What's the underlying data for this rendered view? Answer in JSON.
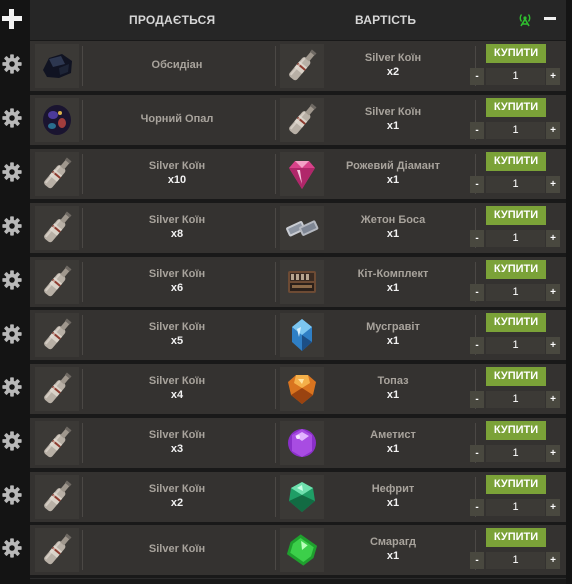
{
  "header": {
    "sells_label": "ПРОДАЄТЬСЯ",
    "cost_label": "ВАРТІСТЬ"
  },
  "colors": {
    "buy_button": "#7ba238",
    "row_background": "#343230",
    "text_name": "#a8a39c",
    "text_qty": "#f2f2f2",
    "accent_icon": "#2fbf2f"
  },
  "rows": [
    {
      "sell": {
        "name": "Обсидіан",
        "qty": "",
        "icon": "obsidian-icon"
      },
      "cost": {
        "name": "Silver Коїн",
        "qty": "x2",
        "icon": "silver-coin-bottle-icon"
      },
      "buy_label": "КУПИТИ",
      "quantity": "1",
      "minus": "-",
      "plus": "+"
    },
    {
      "sell": {
        "name": "Чорний Опал",
        "qty": "",
        "icon": "black-opal-icon"
      },
      "cost": {
        "name": "Silver Коїн",
        "qty": "x1",
        "icon": "silver-coin-bottle-icon"
      },
      "buy_label": "КУПИТИ",
      "quantity": "1",
      "minus": "-",
      "plus": "+"
    },
    {
      "sell": {
        "name": "Silver Коїн",
        "qty": "x10",
        "icon": "silver-coin-bottle-icon"
      },
      "cost": {
        "name": "Рожевий Діамант",
        "qty": "x1",
        "icon": "pink-diamond-icon"
      },
      "buy_label": "КУПИТИ",
      "quantity": "1",
      "minus": "-",
      "plus": "+"
    },
    {
      "sell": {
        "name": "Silver Коїн",
        "qty": "x8",
        "icon": "silver-coin-bottle-icon"
      },
      "cost": {
        "name": "Жетон Боса",
        "qty": "x1",
        "icon": "boss-token-icon"
      },
      "buy_label": "КУПИТИ",
      "quantity": "1",
      "minus": "-",
      "plus": "+"
    },
    {
      "sell": {
        "name": "Silver Коїн",
        "qty": "x6",
        "icon": "silver-coin-bottle-icon"
      },
      "cost": {
        "name": "Кіт-Комплект",
        "qty": "x1",
        "icon": "kit-case-icon"
      },
      "buy_label": "КУПИТИ",
      "quantity": "1",
      "minus": "-",
      "plus": "+"
    },
    {
      "sell": {
        "name": "Silver Коїн",
        "qty": "x5",
        "icon": "silver-coin-bottle-icon"
      },
      "cost": {
        "name": "Мусгравіт",
        "qty": "x1",
        "icon": "musgravite-icon"
      },
      "buy_label": "КУПИТИ",
      "quantity": "1",
      "minus": "-",
      "plus": "+"
    },
    {
      "sell": {
        "name": "Silver Коїн",
        "qty": "x4",
        "icon": "silver-coin-bottle-icon"
      },
      "cost": {
        "name": "Топаз",
        "qty": "x1",
        "icon": "topaz-icon"
      },
      "buy_label": "КУПИТИ",
      "quantity": "1",
      "minus": "-",
      "plus": "+"
    },
    {
      "sell": {
        "name": "Silver Коїн",
        "qty": "x3",
        "icon": "silver-coin-bottle-icon"
      },
      "cost": {
        "name": "Аметист",
        "qty": "x1",
        "icon": "amethyst-icon"
      },
      "buy_label": "КУПИТИ",
      "quantity": "1",
      "minus": "-",
      "plus": "+"
    },
    {
      "sell": {
        "name": "Silver Коїн",
        "qty": "x2",
        "icon": "silver-coin-bottle-icon"
      },
      "cost": {
        "name": "Нефрит",
        "qty": "x1",
        "icon": "jade-icon"
      },
      "buy_label": "КУПИТИ",
      "quantity": "1",
      "minus": "-",
      "plus": "+"
    },
    {
      "sell": {
        "name": "Silver Коїн",
        "qty": "",
        "icon": "silver-coin-bottle-icon"
      },
      "cost": {
        "name": "Смарагд",
        "qty": "x1",
        "icon": "emerald-icon"
      },
      "buy_label": "КУПИТИ",
      "quantity": "1",
      "minus": "-",
      "plus": "+"
    }
  ]
}
